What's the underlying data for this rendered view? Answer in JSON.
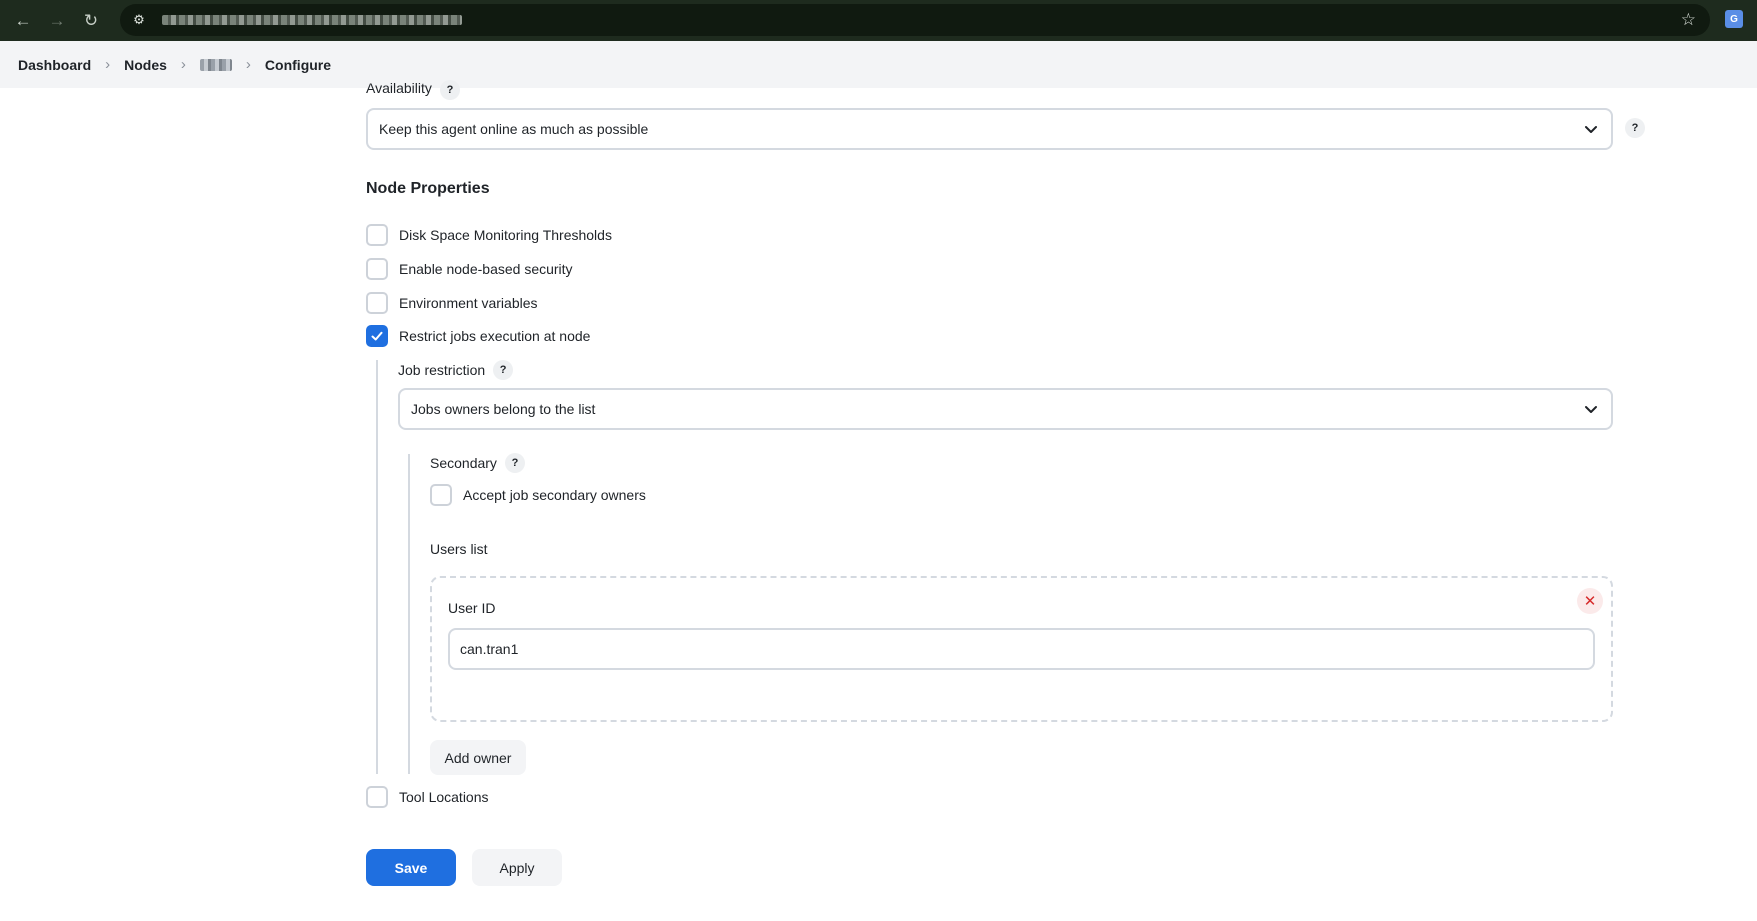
{
  "browser": {
    "back_glyph": "←",
    "forward_glyph": "→",
    "reload_glyph": "↻",
    "site_info_glyph": "⚙",
    "star_glyph": "☆",
    "extension_label": "G",
    "icons": [
      "back-arrow-icon",
      "forward-arrow-icon",
      "reload-icon",
      "site-info-icon",
      "star-icon",
      "translate-icon"
    ]
  },
  "breadcrumb": {
    "items": [
      "Dashboard",
      "Nodes",
      "Configure"
    ],
    "separator": "›"
  },
  "availability": {
    "label": "Availability",
    "help": "?",
    "value": "Keep this agent online as much as possible"
  },
  "node_properties": {
    "title": "Node Properties",
    "options": [
      {
        "label": "Disk Space Monitoring Thresholds",
        "checked": false
      },
      {
        "label": "Enable node-based security",
        "checked": false
      },
      {
        "label": "Environment variables",
        "checked": false
      },
      {
        "label": "Restrict jobs execution at node",
        "checked": true
      },
      {
        "label": "Tool Locations",
        "checked": false
      }
    ]
  },
  "job_restriction": {
    "label": "Job restriction",
    "help": "?",
    "value": "Jobs owners belong to the list",
    "secondary": {
      "label": "Secondary",
      "help": "?",
      "accept_label": "Accept job secondary owners",
      "accept_checked": false
    },
    "users_list": {
      "label": "Users list",
      "user_id_label": "User ID",
      "user_id_value": "can.tran1",
      "remove_glyph": "✕",
      "add_owner_label": "Add owner"
    }
  },
  "actions": {
    "save_label": "Save",
    "apply_label": "Apply"
  },
  "colors": {
    "primary": "#1f6fe0",
    "danger": "#d62b2b",
    "border": "#d4d9e0",
    "breadcrumb_bg": "#f3f4f6",
    "browser_bg": "#1e2b1e"
  }
}
